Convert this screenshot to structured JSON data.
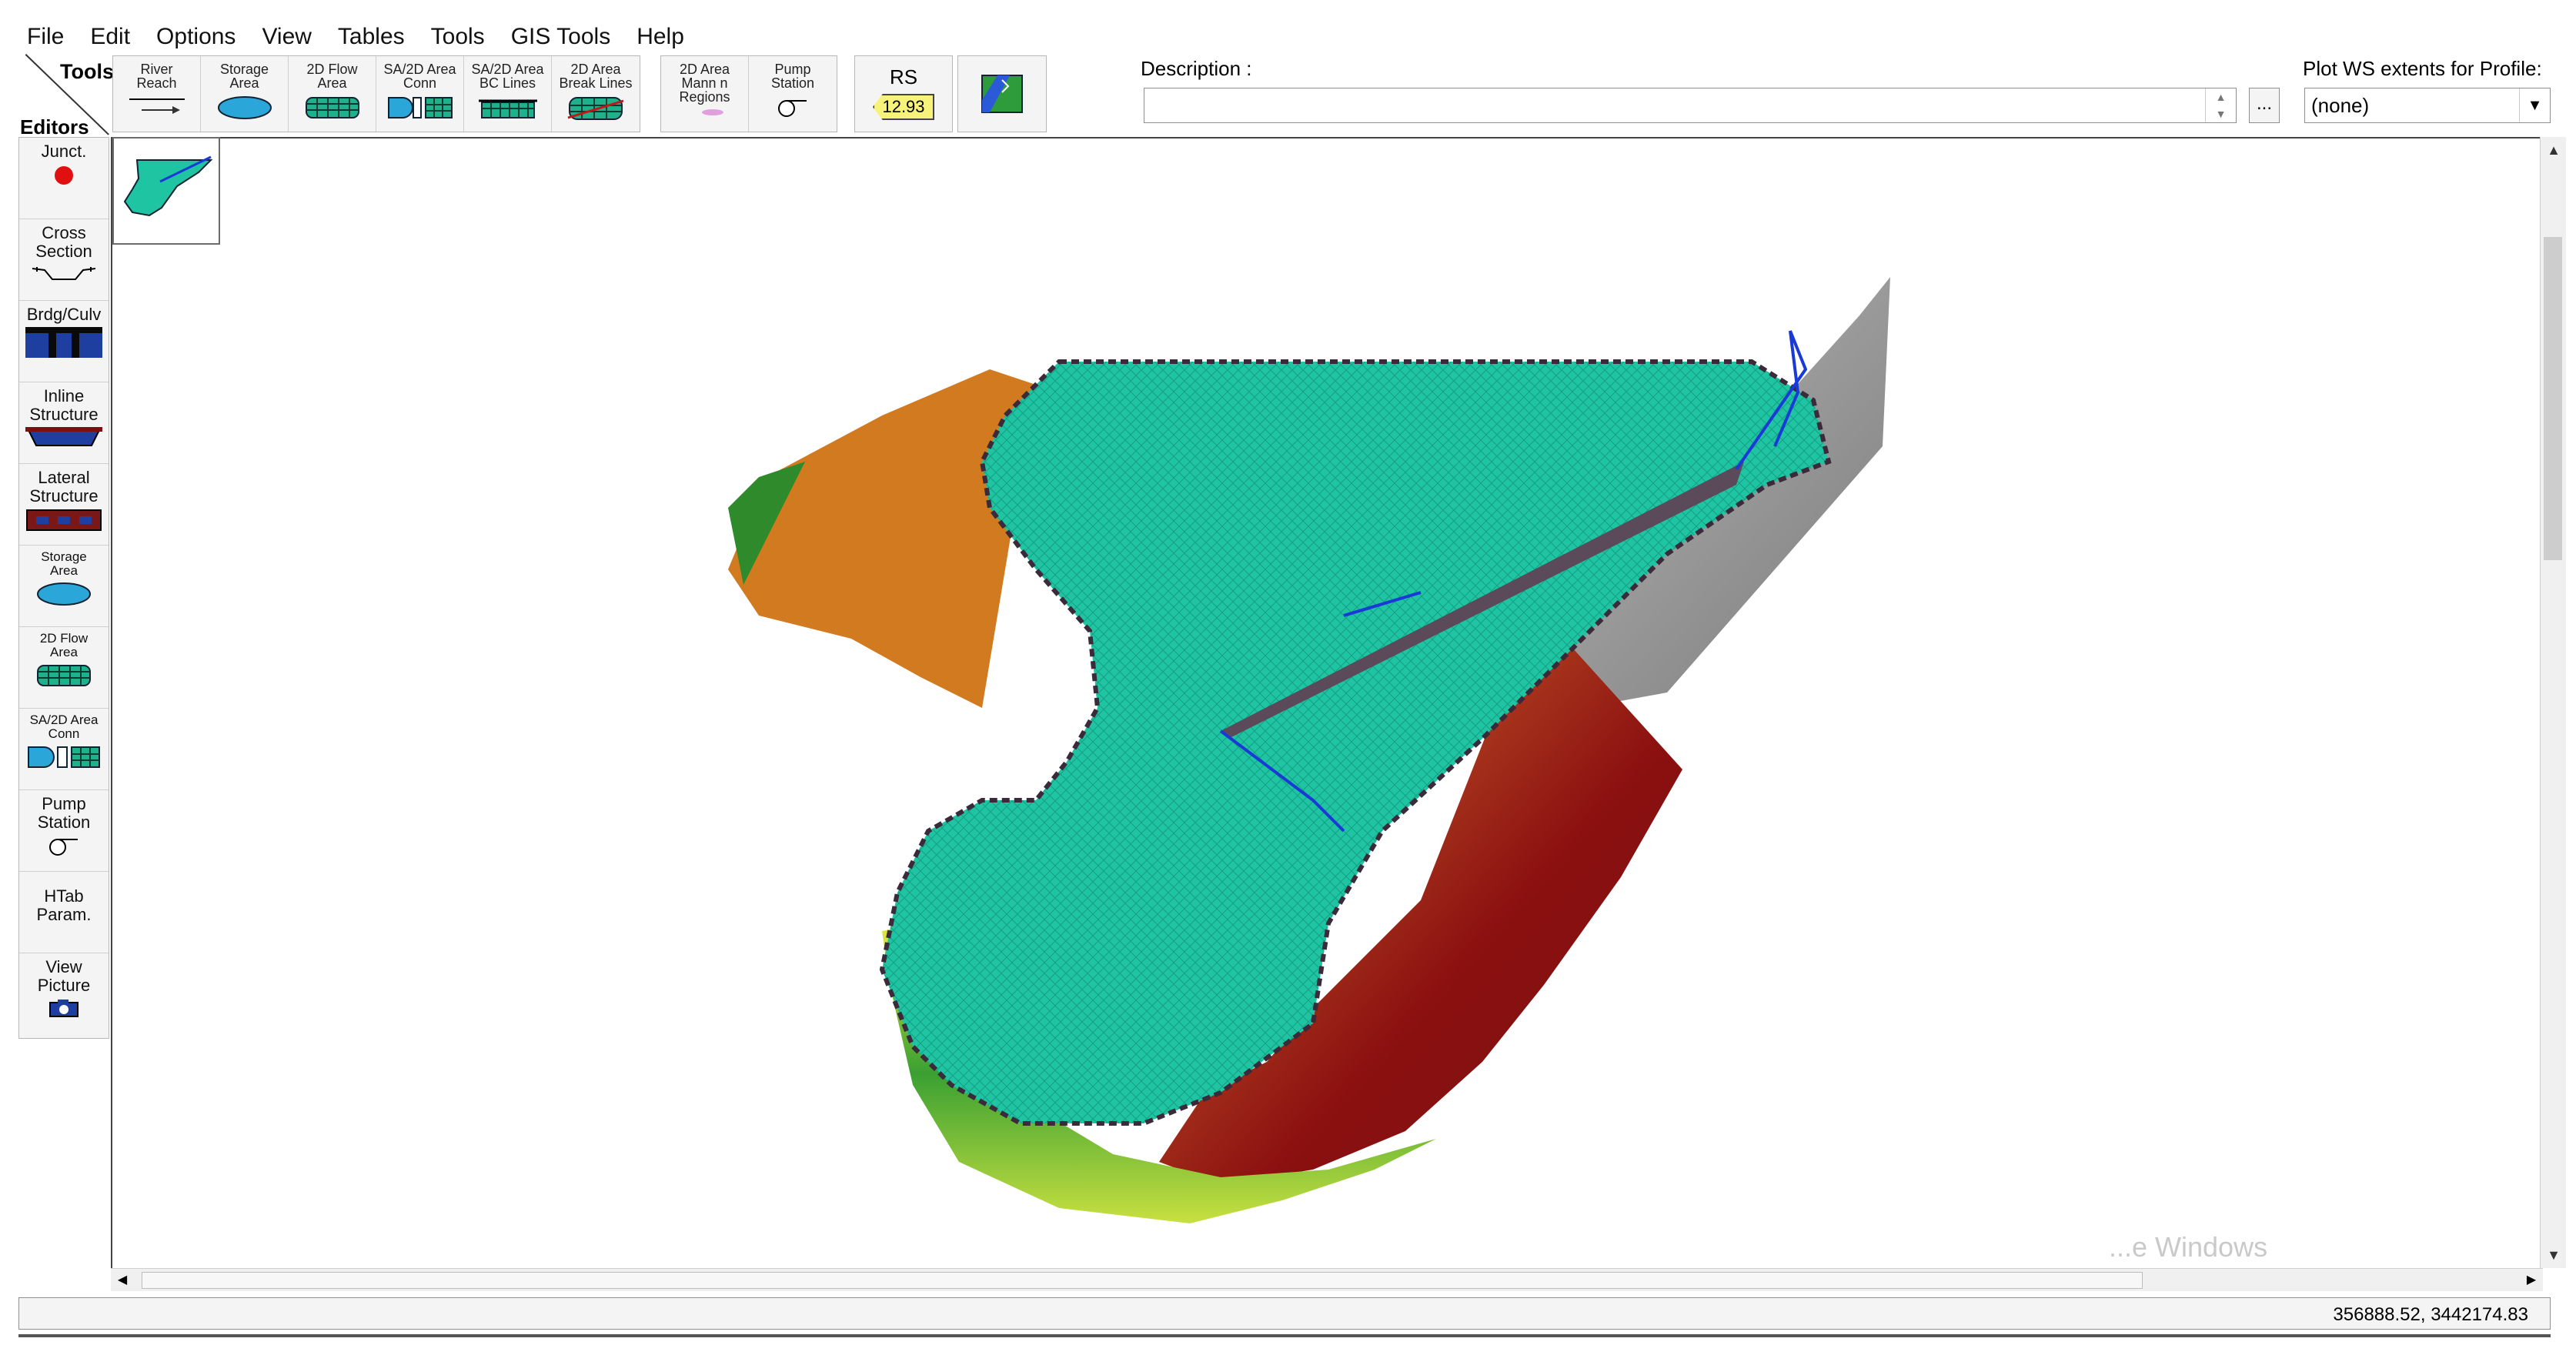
{
  "menu": [
    "File",
    "Edit",
    "Options",
    "View",
    "Tables",
    "Tools",
    "GIS Tools",
    "Help"
  ],
  "toolbar": {
    "tools_label": "Tools",
    "editors_label": "Editors",
    "buttons": [
      {
        "label": "River\nReach",
        "icon": "river-reach-icon"
      },
      {
        "label": "Storage\nArea",
        "icon": "storage-area-icon"
      },
      {
        "label": "2D Flow\nArea",
        "icon": "2d-flow-area-icon"
      },
      {
        "label": "SA/2D Area\nConn",
        "icon": "sa-2d-conn-icon"
      },
      {
        "label": "SA/2D Area\nBC Lines",
        "icon": "bc-lines-icon"
      },
      {
        "label": "2D Area\nBreak Lines",
        "icon": "break-lines-icon"
      },
      {
        "label": "2D Area\nMann n\nRegions",
        "icon": "mann-n-regions-icon"
      },
      {
        "label": "Pump\nStation",
        "icon": "pump-station-icon"
      }
    ],
    "rs_label": "RS",
    "rs_value": "12.93",
    "gis_icon": "gis-map-icon"
  },
  "description": {
    "label": "Description :",
    "value": ""
  },
  "ellipsis": "...",
  "plot_ws": {
    "label": "Plot WS extents for Profile:",
    "selected": "(none)"
  },
  "editors": [
    {
      "label": "Junct.",
      "icon": "junction-icon"
    },
    {
      "label": "Cross\nSection",
      "icon": "cross-section-icon"
    },
    {
      "label": "Brdg/Culv",
      "icon": "bridge-culvert-icon"
    },
    {
      "label": "Inline\nStructure",
      "icon": "inline-structure-icon"
    },
    {
      "label": "Lateral\nStructure",
      "icon": "lateral-structure-icon"
    },
    {
      "label": "Storage\nArea",
      "icon": "storage-area-icon"
    },
    {
      "label": "2D Flow\nArea",
      "icon": "2d-flow-area-icon"
    },
    {
      "label": "SA/2D Area\nConn",
      "icon": "sa-2d-conn-icon"
    },
    {
      "label": "Pump\nStation",
      "icon": "pump-station-icon"
    },
    {
      "label": "HTab\nParam.",
      "icon": ""
    },
    {
      "label": "View\nPicture",
      "icon": "camera-icon"
    }
  ],
  "watermark": "...e Windows",
  "status": {
    "coordinates": "356888.52, 3442174.83"
  },
  "colors": {
    "flow_area": "#1fc4a2",
    "terrain_high": "#8b1010",
    "terrain_mid": "#d8a020",
    "terrain_low": "#1f8a2a",
    "terrain_gray": "#9a9a9a"
  }
}
